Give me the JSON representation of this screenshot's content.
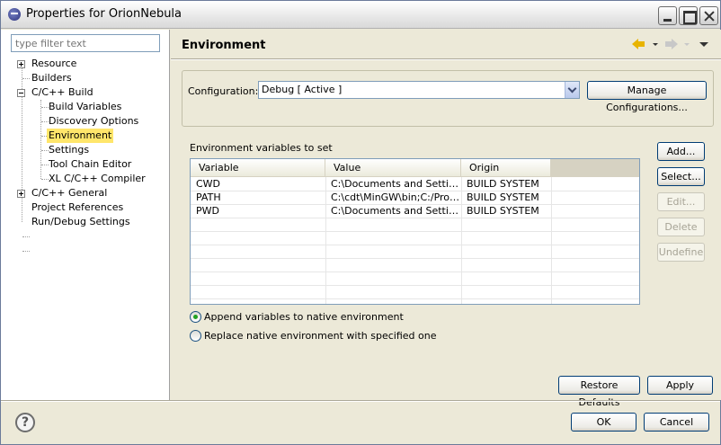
{
  "window": {
    "title": "Properties for OrionNebula"
  },
  "filter": {
    "placeholder": "type filter text"
  },
  "tree": [
    {
      "label": "Resource",
      "expander": "plus"
    },
    {
      "label": "Builders"
    },
    {
      "label": "C/C++ Build",
      "expander": "minus"
    },
    {
      "label": "Build Variables"
    },
    {
      "label": "Discovery Options"
    },
    {
      "label": "Environment",
      "selected": true
    },
    {
      "label": "Settings"
    },
    {
      "label": "Tool Chain Editor"
    },
    {
      "label": "XL C/C++ Compiler"
    },
    {
      "label": "C/C++ General",
      "expander": "plus"
    },
    {
      "label": "Project References"
    },
    {
      "label": "Run/Debug Settings"
    }
  ],
  "page": {
    "title": "Environment"
  },
  "configuration": {
    "label": "Configuration:",
    "value": "Debug  [ Active ]",
    "manage_label": "Manage Configurations..."
  },
  "env": {
    "label": "Environment variables to set",
    "columns": [
      "Variable",
      "Value",
      "Origin"
    ],
    "rows": [
      [
        "CWD",
        "C:\\Documents and Setting...",
        "BUILD SYSTEM"
      ],
      [
        "PATH",
        "C:\\cdt\\MinGW\\bin;C:/Prog...",
        "BUILD SYSTEM"
      ],
      [
        "PWD",
        "C:\\Documents and Setting...",
        "BUILD SYSTEM"
      ]
    ]
  },
  "side_buttons": {
    "add": "Add...",
    "select": "Select...",
    "edit": "Edit...",
    "delete": "Delete",
    "undefine": "Undefine"
  },
  "radios": {
    "append": "Append variables to native environment",
    "replace": "Replace native environment with specified one"
  },
  "buttons": {
    "restore": "Restore Defaults",
    "apply": "Apply",
    "ok": "OK",
    "cancel": "Cancel"
  },
  "icons": {
    "app": "eclipse-icon",
    "help": "help-icon",
    "back": "back-arrow-icon",
    "forward": "forward-arrow-icon"
  }
}
